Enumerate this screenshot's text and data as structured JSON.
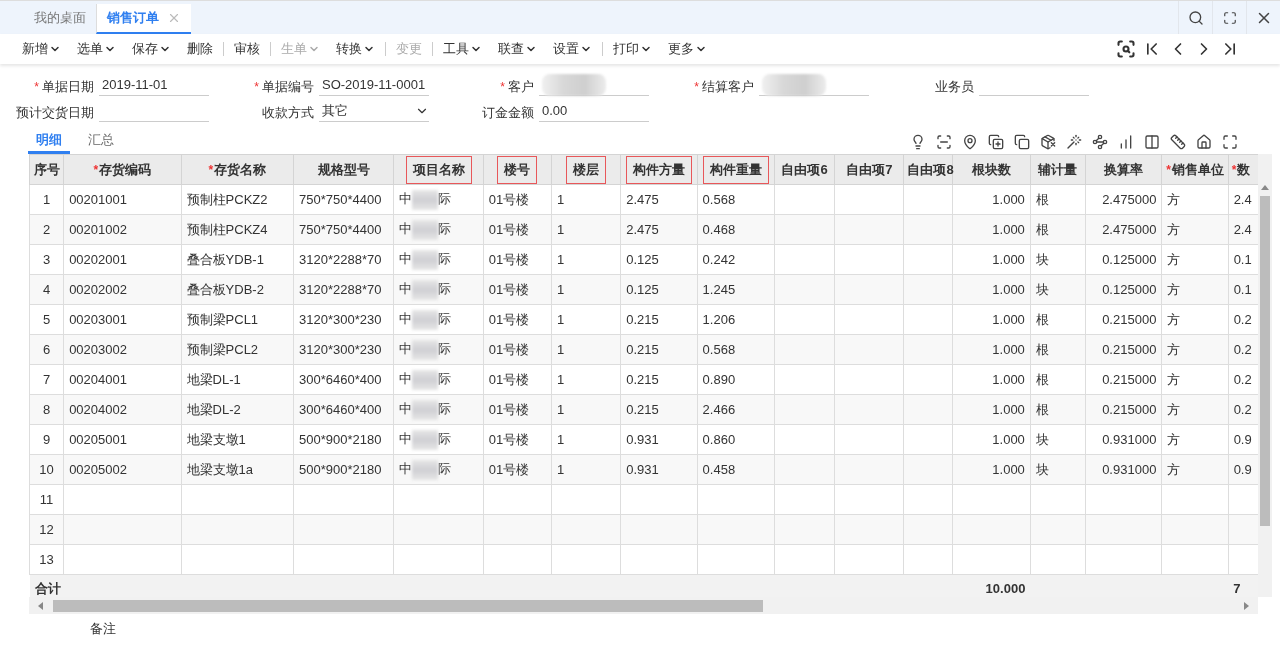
{
  "tabs": [
    {
      "label": "我的桌面",
      "selected": false,
      "closable": false
    },
    {
      "label": "销售订单",
      "selected": true,
      "closable": true
    }
  ],
  "toolbar": [
    {
      "kind": "button",
      "label": "新增",
      "dropdown": true,
      "disabled": false
    },
    {
      "kind": "button",
      "label": "选单",
      "dropdown": true,
      "disabled": false
    },
    {
      "kind": "button",
      "label": "保存",
      "dropdown": true,
      "disabled": false
    },
    {
      "kind": "button",
      "label": "删除",
      "dropdown": false,
      "disabled": false
    },
    {
      "kind": "separator"
    },
    {
      "kind": "button",
      "label": "审核",
      "dropdown": false,
      "disabled": false
    },
    {
      "kind": "separator"
    },
    {
      "kind": "button",
      "label": "生单",
      "dropdown": true,
      "disabled": true
    },
    {
      "kind": "button",
      "label": "转换",
      "dropdown": true,
      "disabled": false
    },
    {
      "kind": "separator"
    },
    {
      "kind": "button",
      "label": "变更",
      "dropdown": false,
      "disabled": true
    },
    {
      "kind": "separator"
    },
    {
      "kind": "button",
      "label": "工具",
      "dropdown": true,
      "disabled": false
    },
    {
      "kind": "button",
      "label": "联查",
      "dropdown": true,
      "disabled": false
    },
    {
      "kind": "button",
      "label": "设置",
      "dropdown": true,
      "disabled": false
    },
    {
      "kind": "separator"
    },
    {
      "kind": "button",
      "label": "打印",
      "dropdown": true,
      "disabled": false
    },
    {
      "kind": "button",
      "label": "更多",
      "dropdown": true,
      "disabled": false
    }
  ],
  "form": [
    [
      {
        "label": "单据日期",
        "marker": "*",
        "kind": "text",
        "value": "2019-11-01"
      },
      {
        "label": "单据编号",
        "marker": "*",
        "kind": "text",
        "value": "SO-2019-11-0001"
      },
      {
        "label": "客户",
        "marker": "*",
        "kind": "blurred"
      },
      {
        "label": "结算客户",
        "marker": "*",
        "kind": "blurred"
      },
      {
        "label": "业务员",
        "kind": "text"
      }
    ],
    [
      {
        "label": "预计交货日期",
        "kind": "text"
      },
      {
        "label": "收款方式",
        "kind": "select",
        "value": "其它"
      },
      {
        "label": "订金金额",
        "kind": "text",
        "value": "0.00"
      }
    ]
  ],
  "subtabs": [
    {
      "label": "明细",
      "selected": true
    },
    {
      "label": "汇总",
      "selected": false
    }
  ],
  "table": {
    "columns": [
      {
        "label": "序号",
        "highlighted": false
      },
      {
        "label": "存货编码",
        "marker": "*",
        "highlighted": false
      },
      {
        "label": "存货名称",
        "marker": "*",
        "highlighted": false
      },
      {
        "label": "规格型号",
        "highlighted": false
      },
      {
        "label": "项目名称",
        "highlighted": true
      },
      {
        "label": "楼号",
        "highlighted": true
      },
      {
        "label": "楼层",
        "highlighted": true
      },
      {
        "label": "构件方量",
        "highlighted": true
      },
      {
        "label": "构件重量",
        "highlighted": true
      },
      {
        "label": "自由项6",
        "highlighted": false
      },
      {
        "label": "自由项7",
        "highlighted": false
      },
      {
        "label": "自由项8",
        "highlighted": false
      },
      {
        "label": "根块数",
        "highlighted": false
      },
      {
        "label": "辅计量",
        "highlighted": false
      },
      {
        "label": "换算率",
        "highlighted": false
      },
      {
        "label": "销售单位",
        "marker": "*",
        "highlighted": false
      },
      {
        "label": "数",
        "marker": "*",
        "highlighted": false
      }
    ],
    "rows": [
      [
        "1",
        "00201001",
        "预制柱PCKZ2",
        "750*750*4400",
        {
          "start": "中",
          "end": "际"
        },
        "01号楼",
        "1",
        "2.475",
        "0.568",
        null,
        null,
        null,
        "1.000",
        "根",
        "2.475000",
        "方",
        "2.4"
      ],
      [
        "2",
        "00201002",
        "预制柱PCKZ4",
        "750*750*4400",
        {
          "start": "中",
          "end": "际"
        },
        "01号楼",
        "1",
        "2.475",
        "0.468",
        null,
        null,
        null,
        "1.000",
        "根",
        "2.475000",
        "方",
        "2.4"
      ],
      [
        "3",
        "00202001",
        "叠合板YDB-1",
        "3120*2288*70",
        {
          "start": "中",
          "end": "际"
        },
        "01号楼",
        "1",
        "0.125",
        "0.242",
        null,
        null,
        null,
        "1.000",
        "块",
        "0.125000",
        "方",
        "0.1"
      ],
      [
        "4",
        "00202002",
        "叠合板YDB-2",
        "3120*2288*70",
        {
          "start": "中",
          "end": "际"
        },
        "01号楼",
        "1",
        "0.125",
        "1.245",
        null,
        null,
        null,
        "1.000",
        "块",
        "0.125000",
        "方",
        "0.1"
      ],
      [
        "5",
        "00203001",
        "预制梁PCL1",
        "3120*300*230",
        {
          "start": "中",
          "end": "际"
        },
        "01号楼",
        "1",
        "0.215",
        "1.206",
        null,
        null,
        null,
        "1.000",
        "根",
        "0.215000",
        "方",
        "0.2"
      ],
      [
        "6",
        "00203002",
        "预制梁PCL2",
        "3120*300*230",
        {
          "start": "中",
          "end": "际"
        },
        "01号楼",
        "1",
        "0.215",
        "0.568",
        null,
        null,
        null,
        "1.000",
        "根",
        "0.215000",
        "方",
        "0.2"
      ],
      [
        "7",
        "00204001",
        "地梁DL-1",
        "300*6460*400",
        {
          "start": "中",
          "end": "际"
        },
        "01号楼",
        "1",
        "0.215",
        "0.890",
        null,
        null,
        null,
        "1.000",
        "根",
        "0.215000",
        "方",
        "0.2"
      ],
      [
        "8",
        "00204002",
        "地梁DL-2",
        "300*6460*400",
        {
          "start": "中",
          "end": "际"
        },
        "01号楼",
        "1",
        "0.215",
        "2.466",
        null,
        null,
        null,
        "1.000",
        "根",
        "0.215000",
        "方",
        "0.2"
      ],
      [
        "9",
        "00205001",
        "地梁支墩1",
        "500*900*2180",
        {
          "start": "中",
          "end": "际"
        },
        "01号楼",
        "1",
        "0.931",
        "0.860",
        null,
        null,
        null,
        "1.000",
        "块",
        "0.931000",
        "方",
        "0.9"
      ],
      [
        "10",
        "00205002",
        "地梁支墩1a",
        "500*900*2180",
        {
          "start": "中",
          "end": "际"
        },
        "01号楼",
        "1",
        "0.931",
        "0.458",
        null,
        null,
        null,
        "1.000",
        "块",
        "0.931000",
        "方",
        "0.9"
      ],
      [
        "11"
      ],
      [
        "12"
      ],
      [
        "13"
      ]
    ],
    "totals": {
      "label": "合计",
      "pieces": "10.000",
      "quantity": "7"
    }
  },
  "remark": {
    "label": "备注"
  }
}
